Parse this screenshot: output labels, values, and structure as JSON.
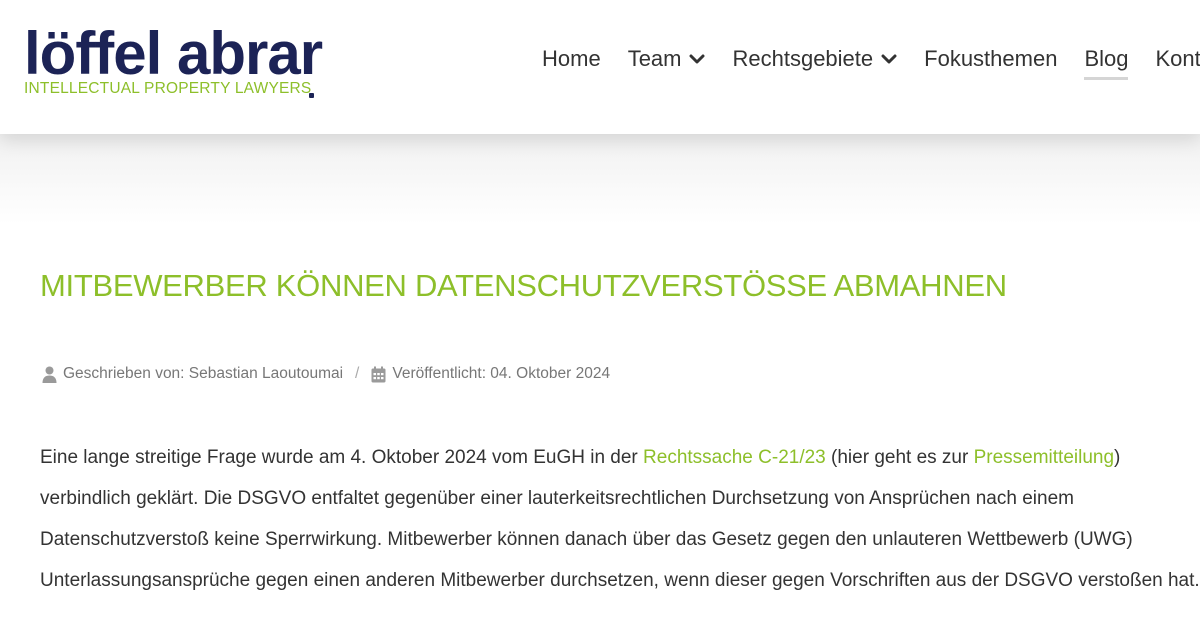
{
  "logo": {
    "name": "löffel abrar",
    "tagline": "INTELLECTUAL PROPERTY LAWYERS"
  },
  "nav": {
    "items": [
      {
        "label": "Home",
        "has_dropdown": false,
        "active": false
      },
      {
        "label": "Team",
        "has_dropdown": true,
        "active": false
      },
      {
        "label": "Rechtsgebiete",
        "has_dropdown": true,
        "active": false
      },
      {
        "label": "Fokusthemen",
        "has_dropdown": false,
        "active": false
      },
      {
        "label": "Blog",
        "has_dropdown": false,
        "active": true
      },
      {
        "label": "Kontakt",
        "has_dropdown": false,
        "active": false
      }
    ]
  },
  "article": {
    "title": "MITBEWERBER KÖNNEN DATENSCHUTZVERSTÖSSE ABMAHNEN",
    "meta": {
      "author_label": "Geschrieben von: Sebastian Laoutoumai",
      "published_label": "Veröffentlicht: 04. Oktober 2024",
      "separator": "/"
    },
    "body": {
      "part1": "Eine lange streitige Frage wurde am 4. Oktober 2024 vom EuGH in der ",
      "link1": "Rechtssache C-21/23",
      "part2": " (hier geht es zur ",
      "link2": "Pressemitteilung",
      "part3": ") verbindlich geklärt. Die DSGVO entfaltet gegenüber einer lauterkeitsrechtlichen Durchsetzung von Ansprüchen nach einem Datenschutzverstoß keine Sperrwirkung. Mitbewerber können danach über das Gesetz gegen den unlauteren Wettbewerb (UWG) Unterlassungsansprüche gegen einen anderen Mitbewerber durchsetzen, wenn dieser gegen Vorschriften aus der DSGVO verstoßen hat."
    }
  },
  "colors": {
    "accent_green": "#8dbf2a",
    "brand_navy": "#1c2356",
    "text": "#333333",
    "meta_text": "#777777"
  },
  "icons": {
    "author": "user-icon",
    "date": "calendar-icon",
    "dropdown": "chevron-down-icon"
  }
}
